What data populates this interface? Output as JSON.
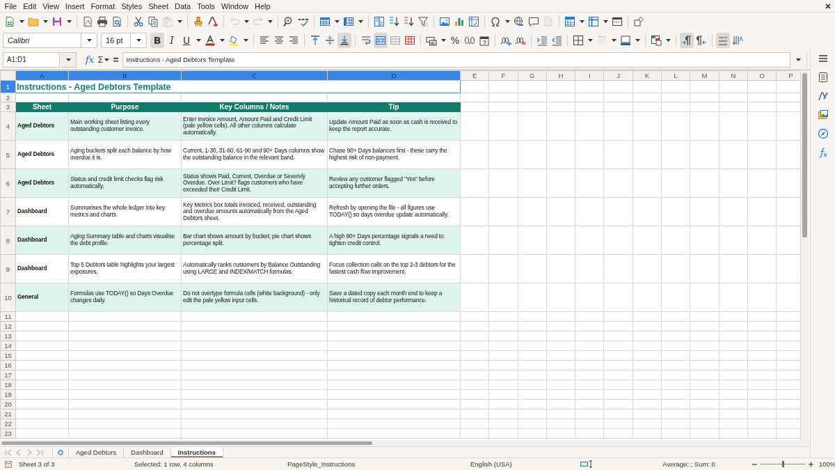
{
  "menu": [
    "File",
    "Edit",
    "View",
    "Insert",
    "Format",
    "Styles",
    "Sheet",
    "Data",
    "Tools",
    "Window",
    "Help"
  ],
  "standard_toolbar": {
    "disabled": {
      "paste": true,
      "undo": true,
      "redo": true,
      "header_footer": true
    }
  },
  "formatting_toolbar": {
    "font_name": "Calibri",
    "font_size": "16 pt",
    "bold": {
      "label": "B",
      "pressed": true
    },
    "italic": {
      "label": "I",
      "pressed": false
    },
    "underline": {
      "label": "U",
      "pressed": false
    },
    "percent": "%",
    "pressed": {
      "align_left": false,
      "align_center": false,
      "align_right": false,
      "align_top": false,
      "align_middle": false,
      "align_bottom": true,
      "wrap_text": false,
      "merge_and_center": true,
      "left_to_right": true,
      "right_to_left": false,
      "text_horizontal": true,
      "text_vertical": false
    },
    "disabled": {
      "border_style": true
    }
  },
  "formula_bar": {
    "name_box": "A1:D1",
    "function_wizard": "fx",
    "sum": "Σ",
    "equals": "=",
    "formula": "Instructions - Aged Debtors Template"
  },
  "columns": [
    {
      "label": "A",
      "selected": true
    },
    {
      "label": "B",
      "selected": true
    },
    {
      "label": "C",
      "selected": true
    },
    {
      "label": "D",
      "selected": true
    },
    {
      "label": "E",
      "selected": false
    },
    {
      "label": "F",
      "selected": false
    },
    {
      "label": "G",
      "selected": false
    },
    {
      "label": "H",
      "selected": false
    },
    {
      "label": "I",
      "selected": false
    },
    {
      "label": "J",
      "selected": false
    },
    {
      "label": "K",
      "selected": false
    },
    {
      "label": "L",
      "selected": false
    },
    {
      "label": "M",
      "selected": false
    },
    {
      "label": "N",
      "selected": false
    },
    {
      "label": "O",
      "selected": false
    },
    {
      "label": "P",
      "selected": false
    }
  ],
  "row_headers": [
    {
      "label": "1",
      "selected": true
    },
    {
      "label": "2",
      "selected": false
    },
    {
      "label": "3",
      "selected": false
    },
    {
      "label": "4",
      "selected": false
    },
    {
      "label": "5",
      "selected": false
    },
    {
      "label": "6",
      "selected": false
    },
    {
      "label": "7",
      "selected": false
    },
    {
      "label": "8",
      "selected": false
    },
    {
      "label": "9",
      "selected": false
    },
    {
      "label": "10",
      "selected": false
    },
    {
      "label": "11",
      "selected": false
    },
    {
      "label": "12",
      "selected": false
    },
    {
      "label": "13",
      "selected": false
    },
    {
      "label": "14",
      "selected": false
    },
    {
      "label": "15",
      "selected": false
    },
    {
      "label": "16",
      "selected": false
    },
    {
      "label": "17",
      "selected": false
    },
    {
      "label": "18",
      "selected": false
    },
    {
      "label": "19",
      "selected": false
    },
    {
      "label": "20",
      "selected": false
    },
    {
      "label": "21",
      "selected": false
    },
    {
      "label": "22",
      "selected": false
    },
    {
      "label": "23",
      "selected": false
    }
  ],
  "title": "Instructions - Aged Debtors Template",
  "table_headers": [
    "Sheet",
    "Purpose",
    "Key Columns / Notes",
    "Tip"
  ],
  "table_rows": [
    {
      "shaded": true,
      "cells": [
        "Aged Debtors",
        "Main working sheet listing every outstanding customer invoice.",
        "Enter Invoice Amount, Amount Paid and Credit Limit (pale yellow cells). All other columns calculate automatically.",
        "Update Amount Paid as soon as cash is received to keep the report accurate."
      ]
    },
    {
      "shaded": false,
      "cells": [
        "Aged Debtors",
        "Aging buckets split each balance by how overdue it is.",
        "Current, 1-30, 31-60, 61-90 and 90+ Days columns show the outstanding balance in the relevant band.",
        "Chase 90+ Days balances first - these carry the highest risk of non-payment."
      ]
    },
    {
      "shaded": true,
      "cells": [
        "Aged Debtors",
        "Status and credit limit checks flag risk automatically.",
        "Status shows Paid, Current, Overdue or Severely Overdue. Over Limit? flags customers who have exceeded their Credit Limit.",
        "Review any customer flagged \"Yes\" before accepting further orders."
      ]
    },
    {
      "shaded": false,
      "cells": [
        "Dashboard",
        "Summarises the whole ledger into key metrics and charts.",
        "Key Metrics box totals invoiced, received, outstanding and overdue amounts automatically from the Aged Debtors sheet.",
        "Refresh by opening the file - all figures use TODAY() so days overdue update automatically."
      ]
    },
    {
      "shaded": true,
      "cells": [
        "Dashboard",
        "Aging Summary table and charts visualise the debt profile.",
        "Bar chart shows amount by bucket; pie chart shows percentage split.",
        "A high 90+ Days percentage signals a need to tighten credit control."
      ]
    },
    {
      "shaded": false,
      "cells": [
        "Dashboard",
        "Top 5 Debtors table highlights your largest exposures.",
        "Automatically ranks customers by Balance Outstanding using LARGE and INDEX/MATCH formulas.",
        "Focus collection calls on the top 2-3 debtors for the fastest cash flow improvement."
      ]
    },
    {
      "shaded": true,
      "cells": [
        "General",
        "Formulas use TODAY() so Days Overdue changes daily.",
        "Do not overtype formula cells (white background) - only edit the pale yellow input cells.",
        "Save a dated copy each month end to keep a historical record of debtor performance."
      ]
    }
  ],
  "sheet_tabs": [
    {
      "label": "Aged Debtors",
      "selected": false
    },
    {
      "label": "Dashboard",
      "selected": false
    },
    {
      "label": "Instructions",
      "selected": true
    }
  ],
  "status_bar": {
    "sheet": "Sheet 3 of 3",
    "selection": "Selected: 1 row, 4 columns",
    "page_style": "PageStyle_Instructions",
    "language": "English (USA)",
    "summary": "Average: ; Sum: 0",
    "zoom": {
      "level": 0.5,
      "reading": "100%"
    }
  }
}
